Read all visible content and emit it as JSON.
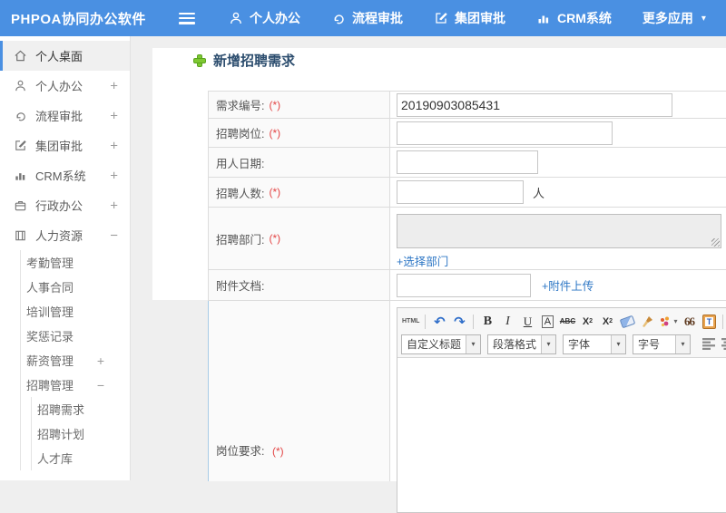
{
  "colors": {
    "topbar_bg": "#4a90e2",
    "active_accent": "#4a90e2",
    "link": "#2e77c5",
    "required": "#e34545",
    "title_text": "#2c4d6e",
    "plus_green": "#7ec832"
  },
  "topbar": {
    "logo": "PHPOA协同办公软件",
    "nav": [
      {
        "label": "个人办公"
      },
      {
        "label": "流程审批"
      },
      {
        "label": "集团审批"
      },
      {
        "label": "CRM系统"
      },
      {
        "label": "更多应用",
        "caret": "▾"
      }
    ]
  },
  "sidebar": {
    "items": [
      {
        "label": "个人桌面",
        "expand": ""
      },
      {
        "label": "个人办公",
        "expand": "+"
      },
      {
        "label": "流程审批",
        "expand": "+"
      },
      {
        "label": "集团审批",
        "expand": "+"
      },
      {
        "label": "CRM系统",
        "expand": "+"
      },
      {
        "label": "行政办公",
        "expand": "+"
      },
      {
        "label": "人力资源",
        "expand": "−"
      }
    ],
    "hr_children": [
      {
        "label": "考勤管理",
        "expand": ""
      },
      {
        "label": "人事合同",
        "expand": ""
      },
      {
        "label": "培训管理",
        "expand": ""
      },
      {
        "label": "奖惩记录",
        "expand": ""
      },
      {
        "label": "薪资管理",
        "expand": "+"
      },
      {
        "label": "招聘管理",
        "expand": "−"
      }
    ],
    "recruit_children": [
      {
        "label": "招聘需求"
      },
      {
        "label": "招聘计划"
      },
      {
        "label": "人才库"
      }
    ]
  },
  "main": {
    "title": "新增招聘需求",
    "form": {
      "req_no": {
        "label": "需求编号:",
        "req": "(*)",
        "value": "20190903085431"
      },
      "position": {
        "label": "招聘岗位:",
        "req": "(*)"
      },
      "date": {
        "label": "用人日期:"
      },
      "count": {
        "label": "招聘人数:",
        "req": "(*)",
        "suffix": "人"
      },
      "dept": {
        "label": "招聘部门:",
        "req": "(*)",
        "link": "+选择部门"
      },
      "attach": {
        "label": "附件文档:",
        "link": "+附件上传"
      },
      "requirement": {
        "label": "岗位要求:",
        "req": "(*)"
      }
    },
    "editor": {
      "html": "HTML",
      "undo": "↶",
      "redo": "↷",
      "bold": "B",
      "italic": "I",
      "underline": "U",
      "boxa": "A",
      "strike": "ABC",
      "sup_base": "X",
      "sup_exp": "2",
      "sub_base": "X",
      "sub_idx": "2",
      "quote": "66",
      "paste_t": "T",
      "font_color": "A",
      "bg_color": "a",
      "caret": "▾",
      "selects": [
        {
          "value": "自定义标题"
        },
        {
          "value": "段落格式"
        },
        {
          "value": "字体"
        },
        {
          "value": "字号"
        }
      ]
    }
  }
}
